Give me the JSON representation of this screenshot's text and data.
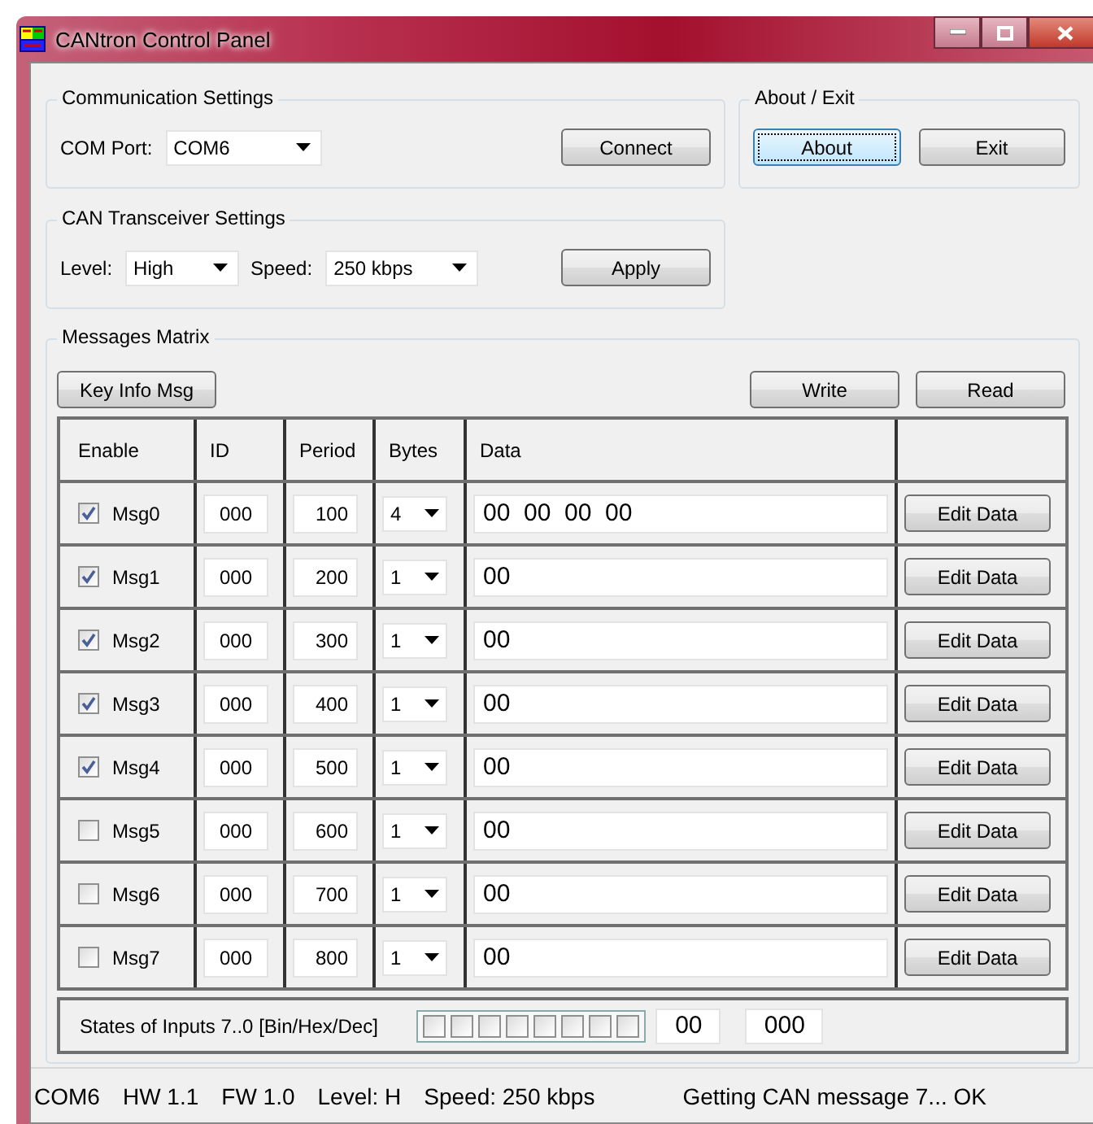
{
  "window": {
    "title": "CANtron Control Panel"
  },
  "communication": {
    "title": "Communication Settings",
    "port_label": "COM Port:",
    "port": "COM6",
    "connect_button": "Connect"
  },
  "about_exit": {
    "title": "About / Exit",
    "buttons": [
      {
        "label": "About",
        "focused": true
      },
      {
        "label": "Exit",
        "focused": false
      }
    ]
  },
  "transceiver": {
    "title": "CAN Transceiver Settings",
    "level_label": "Level:",
    "level": "High",
    "speed_label": "Speed:",
    "speed": "250 kbps",
    "apply_button": "Apply"
  },
  "messages": {
    "title": "Messages Matrix",
    "key_info_button": "Key Info Msg",
    "write_button": "Write",
    "read_button": "Read",
    "columns": [
      "Enable",
      "ID",
      "Period",
      "Bytes",
      "Data"
    ],
    "rows": [
      {
        "name": "Msg0",
        "enabled": true,
        "id": "000",
        "period": "100",
        "bytes": "4",
        "data": "00  00  00  00",
        "button": "Edit Data"
      },
      {
        "name": "Msg1",
        "enabled": true,
        "id": "000",
        "period": "200",
        "bytes": "1",
        "data": "00",
        "button": "Edit Data"
      },
      {
        "name": "Msg2",
        "enabled": true,
        "id": "000",
        "period": "300",
        "bytes": "1",
        "data": "00",
        "button": "Edit Data"
      },
      {
        "name": "Msg3",
        "enabled": true,
        "id": "000",
        "period": "400",
        "bytes": "1",
        "data": "00",
        "button": "Edit Data"
      },
      {
        "name": "Msg4",
        "enabled": true,
        "id": "000",
        "period": "500",
        "bytes": "1",
        "data": "00",
        "button": "Edit Data"
      },
      {
        "name": "Msg5",
        "enabled": false,
        "id": "000",
        "period": "600",
        "bytes": "1",
        "data": "00",
        "button": "Edit Data"
      },
      {
        "name": "Msg6",
        "enabled": false,
        "id": "000",
        "period": "700",
        "bytes": "1",
        "data": "00",
        "button": "Edit Data"
      },
      {
        "name": "Msg7",
        "enabled": false,
        "id": "000",
        "period": "800",
        "bytes": "1",
        "data": "00",
        "button": "Edit Data"
      }
    ],
    "inputs": {
      "label": "States of Inputs 7..0 [Bin/Hex/Dec]",
      "bits": [
        {
          "checked": false
        },
        {
          "checked": false
        },
        {
          "checked": false
        },
        {
          "checked": false
        },
        {
          "checked": false
        },
        {
          "checked": false
        },
        {
          "checked": false
        },
        {
          "checked": false
        }
      ],
      "hex": "00",
      "dec": "000"
    }
  },
  "status_bar": [
    "COM6",
    "HW 1.1",
    "FW 1.0",
    "Level: H",
    "Speed: 250 kbps",
    "Getting CAN message 7... OK"
  ]
}
